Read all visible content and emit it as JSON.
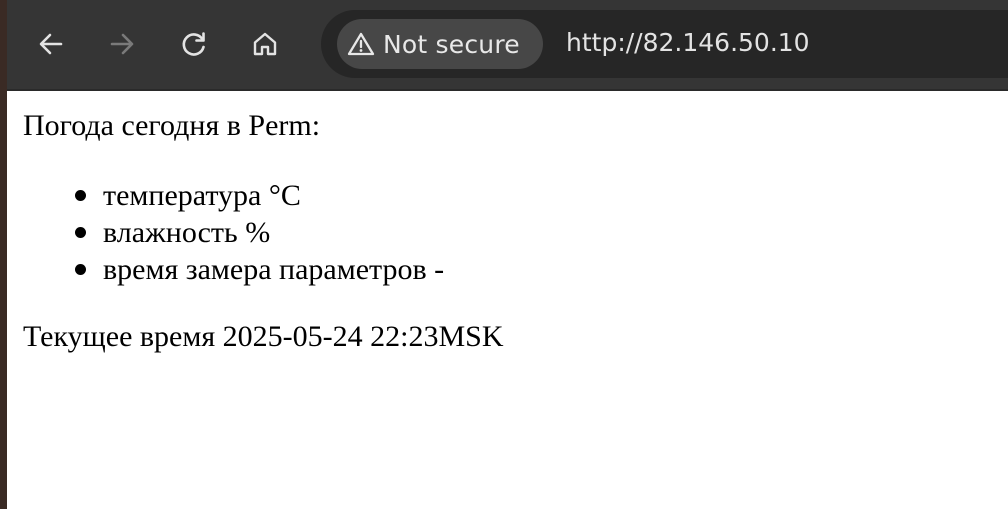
{
  "browser": {
    "security_label": "Not secure",
    "url": "http://82.146.50.10",
    "icons": {
      "back": "arrow-left-icon",
      "forward": "arrow-right-icon",
      "reload": "reload-icon",
      "home": "home-icon",
      "security": "warning-triangle-icon"
    },
    "forward_enabled": false
  },
  "page": {
    "heading": "Погода сегодня в Perm:",
    "items": [
      {
        "label": "температура °C"
      },
      {
        "label": "влажность %"
      },
      {
        "label": "время замера параметров -"
      }
    ],
    "current_time": "Текущее время 2025-05-24 22:23MSK"
  },
  "colors": {
    "toolbar_bg": "#353535",
    "omnibox_bg": "#262626",
    "chip_bg": "#474747",
    "icon_active": "#e3e3e3",
    "icon_disabled": "#7a7a7a",
    "page_bg": "#ffffff",
    "page_text": "#000000"
  }
}
